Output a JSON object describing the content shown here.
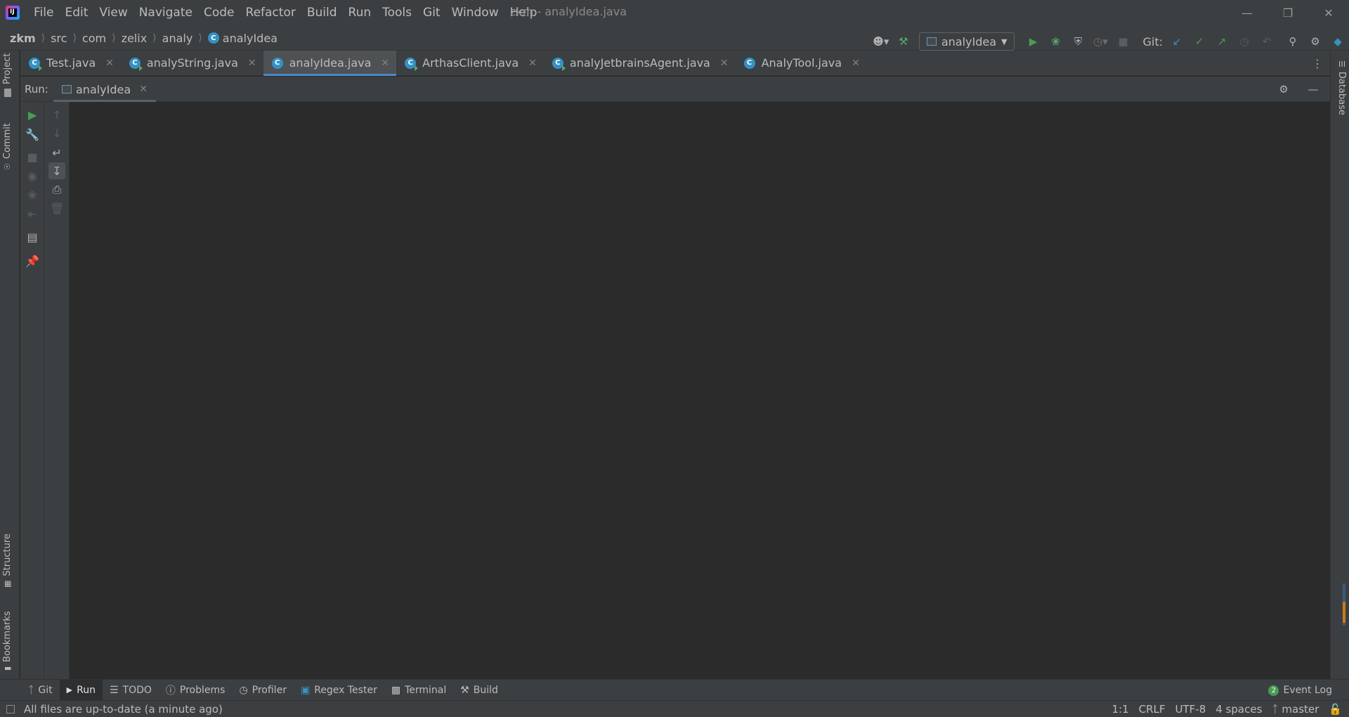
{
  "window": {
    "title": "zkm - analyIdea.java",
    "menu": [
      "File",
      "Edit",
      "View",
      "Navigate",
      "Code",
      "Refactor",
      "Build",
      "Run",
      "Tools",
      "Git",
      "Window",
      "Help"
    ],
    "controls": [
      "minimize",
      "restore",
      "close"
    ]
  },
  "breadcrumb": [
    "zkm",
    "src",
    "com",
    "zelix",
    "analy",
    "analyIdea"
  ],
  "toolbar": {
    "run_config": "analyIdea",
    "git_label": "Git:",
    "icons": [
      "user-menu-icon",
      "build-hammer-icon",
      "run-icon",
      "debug-icon",
      "coverage-icon",
      "profile-icon",
      "stop-icon",
      "git-update-icon",
      "git-commit-icon",
      "git-push-icon",
      "history-icon",
      "rollback-icon",
      "search-icon",
      "settings-icon",
      "jetbrains-toolbox-icon"
    ]
  },
  "left_stripe": [
    "Project",
    "Commit",
    "Structure",
    "Bookmarks"
  ],
  "right_stripe": [
    "Database"
  ],
  "editor_tabs": [
    {
      "label": "Test.java",
      "active": false,
      "runnable": true
    },
    {
      "label": "analyString.java",
      "active": false,
      "runnable": true
    },
    {
      "label": "analyIdea.java",
      "active": true,
      "runnable": false
    },
    {
      "label": "ArthasClient.java",
      "active": false,
      "runnable": true
    },
    {
      "label": "analyJetbrainsAgent.java",
      "active": false,
      "runnable": true
    },
    {
      "label": "AnalyTool.java",
      "active": false,
      "runnable": false
    }
  ],
  "run_panel": {
    "label": "Run:",
    "tab": "analyIdea",
    "console_text": ""
  },
  "bottom_tools": [
    {
      "label": "Git",
      "icon": "git-branch-icon",
      "active": false
    },
    {
      "label": "Run",
      "icon": "run-triangle-icon",
      "active": true
    },
    {
      "label": "TODO",
      "icon": "list-icon",
      "active": false
    },
    {
      "label": "Problems",
      "icon": "problems-icon",
      "active": false
    },
    {
      "label": "Profiler",
      "icon": "profiler-icon",
      "active": false
    },
    {
      "label": "Regex Tester",
      "icon": "regex-icon",
      "active": false
    },
    {
      "label": "Terminal",
      "icon": "terminal-icon",
      "active": false
    },
    {
      "label": "Build",
      "icon": "hammer-icon",
      "active": false
    }
  ],
  "event_log": {
    "label": "Event Log",
    "count": "2"
  },
  "status": {
    "message": "All files are up-to-date (a minute ago)",
    "position": "1:1",
    "line_separator": "CRLF",
    "encoding": "UTF-8",
    "indent": "4 spaces",
    "branch": "master"
  },
  "colors": {
    "accent": "#4a88c7",
    "run_green": "#499c54",
    "class_blue": "#3592c4"
  }
}
